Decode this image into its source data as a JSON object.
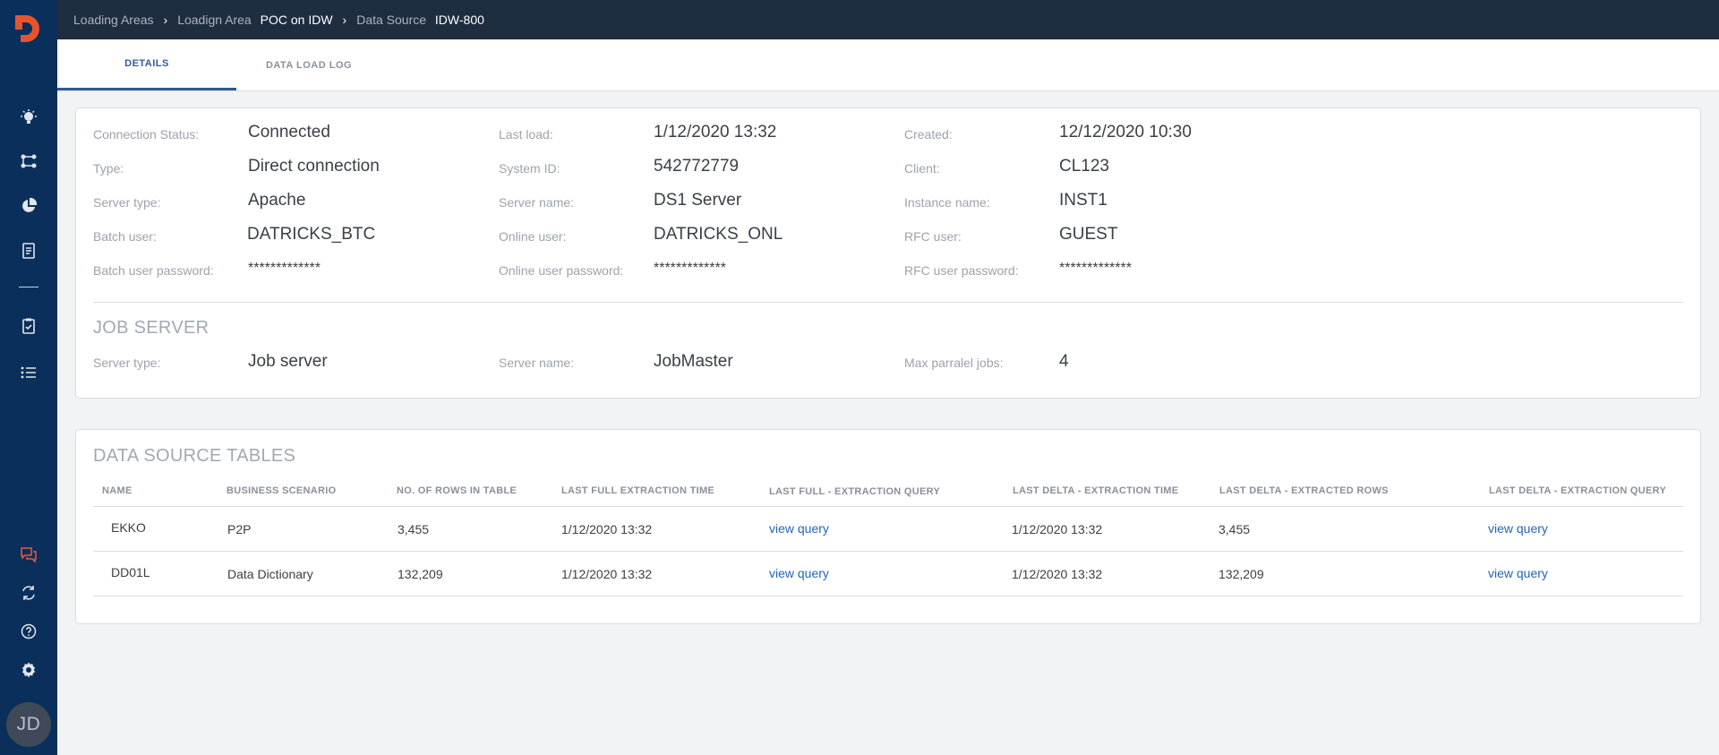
{
  "colors": {
    "sidebar": "#0b2f5b",
    "topbar": "#1f2d40",
    "accent": "#2d5b99",
    "link": "#2365b8",
    "logo": "#e8542a",
    "chat_icon": "#e25b45"
  },
  "sidebar": {
    "icons": [
      "lightbulb-icon",
      "flow-icon",
      "pie-chart-icon",
      "document-icon",
      "clipboard-check-icon",
      "list-icon",
      "chat-icon",
      "refresh-icon",
      "help-icon",
      "gear-icon"
    ],
    "avatar_initials": "JD"
  },
  "breadcrumb": {
    "item1": "Loading Areas",
    "item2_prefix": "Loadign Area",
    "item2_name": "POC on IDW",
    "item3_prefix": "Data Source",
    "item3_name": "IDW-800"
  },
  "tabs": [
    {
      "label": "DETAILS",
      "active": true
    },
    {
      "label": "DATA LOAD LOG",
      "active": false
    }
  ],
  "details": {
    "col1": [
      {
        "label": "Connection Status:",
        "value": "Connected"
      },
      {
        "label": "Type:",
        "value": "Direct connection"
      },
      {
        "label": "Server type:",
        "value": "Apache"
      },
      {
        "label": "Batch user:",
        "value": "DATRICKS_BTC"
      },
      {
        "label": "Batch user password:",
        "value": "*************"
      }
    ],
    "col2": [
      {
        "label": "Last load:",
        "value": "1/12/2020 13:32"
      },
      {
        "label": "System ID:",
        "value": "542772779"
      },
      {
        "label": "Server name:",
        "value": "DS1 Server"
      },
      {
        "label": "Online user:",
        "value": "DATRICKS_ONL"
      },
      {
        "label": "Online user password:",
        "value": "*************"
      }
    ],
    "col3": [
      {
        "label": "Created:",
        "value": "12/12/2020 10:30"
      },
      {
        "label": "Client:",
        "value": "CL123"
      },
      {
        "label": "Instance name:",
        "value": "INST1"
      },
      {
        "label": "RFC user:",
        "value": "GUEST"
      },
      {
        "label": "RFC user password:",
        "value": "*************"
      }
    ]
  },
  "job_server": {
    "title": "JOB SERVER",
    "fields": [
      {
        "label": "Server type:",
        "value": "Job server"
      },
      {
        "label": "Server name:",
        "value": "JobMaster"
      },
      {
        "label": "Max parralel jobs:",
        "value": "4"
      }
    ]
  },
  "tables": {
    "title": "DATA SOURCE TABLES",
    "headers": [
      "NAME",
      "BUSINESS SCENARIO",
      "NO. OF ROWS IN TABLE",
      "LAST FULL EXTRACTION TIME",
      "LAST FULL -  EXTRACTION QUERY",
      "LAST DELTA - EXTRACTION TIME",
      "LAST DELTA - EXTRACTED ROWS",
      "LAST DELTA - EXTRACTION QUERY"
    ],
    "rows": [
      {
        "name": "EKKO",
        "scenario": "P2P",
        "rows": "3,455",
        "full_time": "1/12/2020 13:32",
        "full_query": "view query",
        "delta_time": "1/12/2020 13:32",
        "delta_rows": "3,455",
        "delta_query": "view query"
      },
      {
        "name": "DD01L",
        "scenario": "Data Dictionary",
        "rows": "132,209",
        "full_time": "1/12/2020 13:32",
        "full_query": "view query",
        "delta_time": "1/12/2020 13:32",
        "delta_rows": "132,209",
        "delta_query": "view query"
      }
    ]
  }
}
